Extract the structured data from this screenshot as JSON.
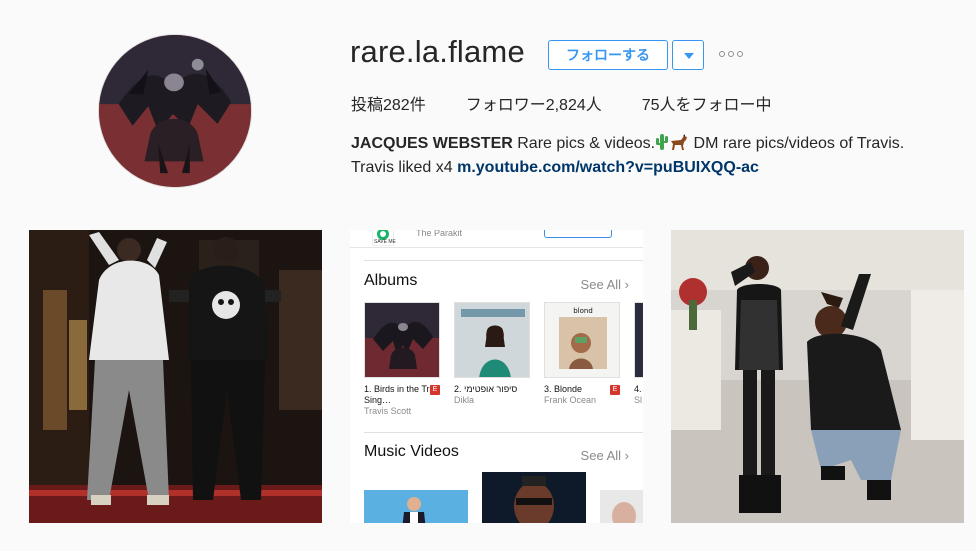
{
  "profile": {
    "username": "rare.la.flame",
    "follow_label": "フォローする",
    "posts": "投稿282件",
    "followers": "フォロワー2,824人",
    "following": "75人をフォロー中",
    "bio_name": "JACQUES WEBSTER",
    "bio_text1": " Rare pics & videos.",
    "bio_text2": " DM rare pics/videos of Travis.",
    "bio_line2": "Travis liked x4 ",
    "bio_link": "m.youtube.com/watch?v=puBUIXQQ-ac"
  },
  "music_screenshot": {
    "partial_track": "The Parakit",
    "save_label": "SAVE ME",
    "albums_title": "Albums",
    "see_all": "See All",
    "music_videos_title": "Music Videos",
    "albums": [
      {
        "title": "1. Birds in the Trap Sing…",
        "artist": "Travis Scott",
        "explicit": "E"
      },
      {
        "title": "2. סיפור אופטימי",
        "artist": "Dikla",
        "explicit": ""
      },
      {
        "title": "3. Blonde",
        "artist": "Frank Ocean",
        "explicit": "E",
        "art_text": "blond"
      },
      {
        "title": "4.",
        "artist": "Sl",
        "explicit": ""
      }
    ]
  },
  "icons": {
    "more": "ellipsis-icon",
    "dropdown": "caret-down-icon"
  },
  "colors": {
    "accent": "#3897f0",
    "link": "#003569",
    "background": "#fafafa"
  }
}
